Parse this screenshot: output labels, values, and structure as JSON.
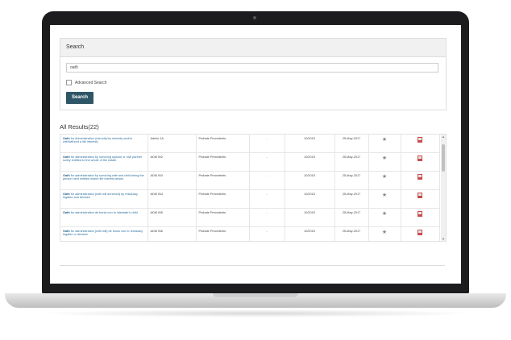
{
  "search": {
    "panel_title": "Search",
    "input_value": "oath",
    "advanced_label": "Advanced Search",
    "button_label": "Search"
  },
  "results": {
    "title": "All Results(22)",
    "rows": [
      {
        "title_lead": "Oath",
        "title_rest": " for Administration (minority/no minority and/or with/without a life interest)",
        "code": "Admin 1A",
        "category": "Probate Precedents",
        "dash": "-",
        "ref": "10/2015",
        "date": "25-May-2017"
      },
      {
        "title_lead": "Oath",
        "title_rest": " for administration by surviving spouse or civil partner solely entitled to the whole of the estate",
        "code": "ADM IN2",
        "category": "Probate Precedents",
        "dash": "-",
        "ref": "10/2015",
        "date": "25-May-2017"
      },
      {
        "title_lead": "Oath",
        "title_rest": " for administration by surviving wife and child being the person next entitled where life interest arises",
        "code": "ADM IN3",
        "category": "Probate Precedents",
        "dash": "-",
        "ref": "10/2015",
        "date": "25-May-2017"
      },
      {
        "title_lead": "Oath",
        "title_rest": " for administration (with will annexed) by residuary legatee and devisee",
        "code": "ADM IN4",
        "category": "Probate Precedents",
        "dash": "-",
        "ref": "10/2015",
        "date": "25-May-2017"
      },
      {
        "title_lead": "Oath",
        "title_rest": " for administration de bonis non to intestate's child",
        "code": "ADM IN5",
        "category": "Probate Precedents",
        "dash": "-",
        "ref": "10/2015",
        "date": "25-May-2017"
      },
      {
        "title_lead": "Oath",
        "title_rest": " for administration (with will) de bonis non to residuary legatee or devisee",
        "code": "ADM IN6",
        "category": "Probate Precedents",
        "dash": "-",
        "ref": "10/2015",
        "date": "25-May-2017"
      }
    ]
  },
  "icons": {
    "favorite": "star-icon",
    "pdf": "pdf-icon"
  }
}
